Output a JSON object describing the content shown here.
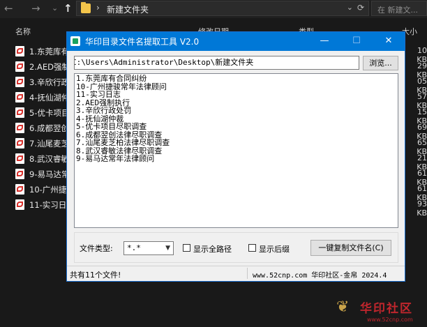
{
  "explorer": {
    "nav": {
      "back": "←",
      "forward": "→",
      "history": "⌄",
      "up": "↑"
    },
    "address": {
      "separator": "›",
      "path": "新建文件夹",
      "chevron": "⌄",
      "refresh": "⟳"
    },
    "search": {
      "placeholder": "在 新建文..."
    },
    "columns": {
      "name": "名称",
      "modified": "修改日期",
      "type": "类型",
      "size": "大小"
    },
    "files": [
      {
        "name": "1.东莞库有",
        "size": "10 KB"
      },
      {
        "name": "2.AED强制",
        "size": "29 KB"
      },
      {
        "name": "3.辛欣行政",
        "size": "05 KB"
      },
      {
        "name": "4-抚仙湖仲",
        "size": "57 KB"
      },
      {
        "name": "5-优卡项目",
        "size": "15 KB"
      },
      {
        "name": "6.成都翌创",
        "size": "69 KB"
      },
      {
        "name": "7.汕尾麦芝",
        "size": "65 KB"
      },
      {
        "name": "8.武汉睿敏",
        "size": "21 KB"
      },
      {
        "name": "9-易马达常",
        "size": "61 KB"
      },
      {
        "name": "10-广州捷",
        "size": "61 KB"
      },
      {
        "name": "11-实习日",
        "size": "93 KB"
      }
    ]
  },
  "tool": {
    "title": "华印目录文件名提取工具 V2.0",
    "controls": {
      "minimize": "—",
      "maximize": "☐",
      "close": "✕"
    },
    "path_value": "C:\\Users\\Administrator\\Desktop\\新建文件夹",
    "browse_label": "浏览...",
    "results": [
      "1.东莞库有合同纠纷",
      "10-广州捷骏常年法律顾问",
      "11-实习日志",
      "2.AED强制执行",
      "3.辛欣行政处罚",
      "4-抚仙湖仲裁",
      "5-优卡项目尽职调查",
      "6.成都翌创法律尽职调查",
      "7.汕尾麦芝柏法律尽职调查",
      "8.武汉睿敏法律尽职调查",
      "9-易马达常年法律顾问"
    ],
    "filetype_label": "文件类型:",
    "filetype_value": "*.*",
    "show_full_path_label": "显示全路径",
    "show_ext_label": "显示后缀",
    "copy_button_label": "一键复制文件名(C)",
    "status_left": "共有11个文件!",
    "status_right": "www.52cnp.com  华印社区-金帛  2024.4"
  },
  "watermark": {
    "main": "华印社区",
    "url": "www.52cnp.com"
  }
}
